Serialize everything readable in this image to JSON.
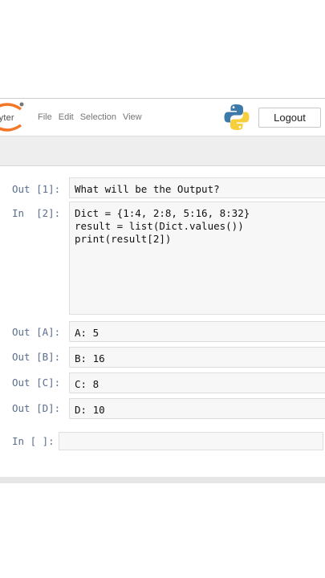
{
  "header": {
    "logo_text": "upyter",
    "menu": [
      "File",
      "Edit",
      "Selection",
      "View"
    ],
    "logout_label": "Logout",
    "python_icon": "python-logo-icon"
  },
  "cells": [
    {
      "prompt": "Out [1]:",
      "content": "What will be the Output?"
    },
    {
      "prompt": "In  [2]:",
      "content": "Dict = {1:4, 2:8, 5:16, 8:32}\nresult = list(Dict.values())\nprint(result[2])"
    },
    {
      "prompt": "Out [A]:",
      "content": "A: 5"
    },
    {
      "prompt": "Out [B]:",
      "content": "B: 16"
    },
    {
      "prompt": "Out [C]:",
      "content": "C: 8"
    },
    {
      "prompt": "Out [D]:",
      "content": "D: 10"
    },
    {
      "prompt": "In [ ]:",
      "content": ""
    }
  ],
  "colors": {
    "prompt": "#5a6e8e",
    "cell_bg": "#f7f7f7",
    "jupyter_orange": "#f37726"
  }
}
